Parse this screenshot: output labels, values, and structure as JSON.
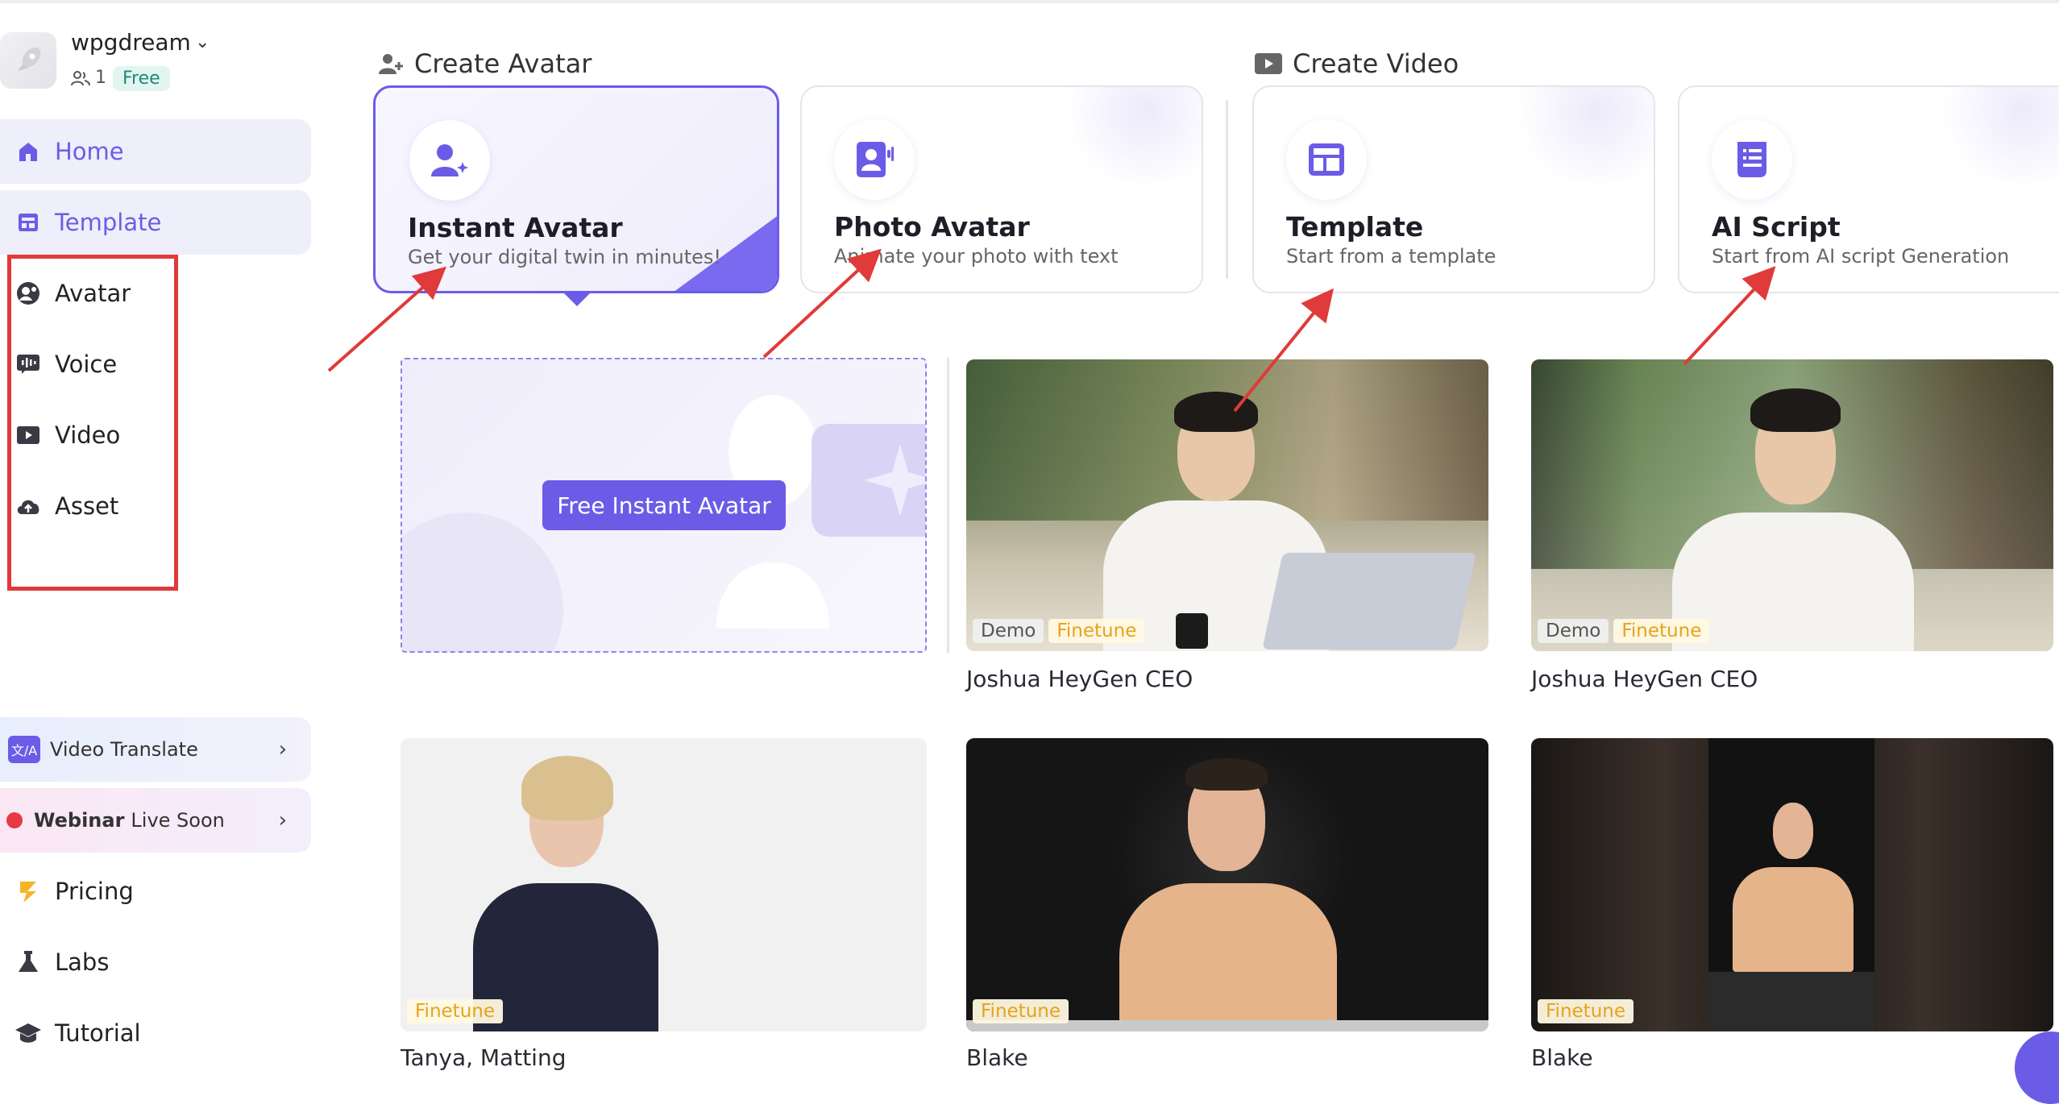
{
  "workspace": {
    "name": "wpgdream",
    "members": "1",
    "plan": "Free"
  },
  "sidebar": {
    "items": [
      {
        "label": "Home",
        "icon": "home-icon"
      },
      {
        "label": "Template",
        "icon": "template-icon"
      },
      {
        "label": "Avatar",
        "icon": "avatar-icon"
      },
      {
        "label": "Voice",
        "icon": "voice-icon"
      },
      {
        "label": "Video",
        "icon": "video-icon"
      },
      {
        "label": "Asset",
        "icon": "cloud-upload-icon"
      }
    ],
    "promos": {
      "translate": {
        "label": "Video Translate",
        "icon_text": "文/A"
      },
      "webinar": {
        "bold": "Webinar",
        "label": "Live Soon"
      }
    },
    "bottom_items": [
      {
        "label": "Pricing",
        "icon": "pricing-icon"
      },
      {
        "label": "Labs",
        "icon": "flask-icon"
      },
      {
        "label": "Tutorial",
        "icon": "graduation-cap-icon"
      }
    ]
  },
  "sections": {
    "create_avatar": "Create Avatar",
    "create_video": "Create Video"
  },
  "cards": [
    {
      "title": "Instant Avatar",
      "subtitle": "Get your digital twin in minutes!"
    },
    {
      "title": "Photo Avatar",
      "subtitle": "Animate your photo with text"
    },
    {
      "title": "Template",
      "subtitle": "Start from a template"
    },
    {
      "title": "AI Script",
      "subtitle": "Start from AI script Generation"
    }
  ],
  "create_tile": {
    "button": "Free Instant Avatar"
  },
  "avatars": [
    {
      "name": "Joshua HeyGen CEO",
      "badges": [
        "Demo",
        "Finetune"
      ]
    },
    {
      "name": "Joshua HeyGen CEO",
      "badges": [
        "Demo",
        "Finetune"
      ]
    },
    {
      "name": "Tanya, Matting",
      "badges": [
        "Finetune"
      ]
    },
    {
      "name": "Blake",
      "badges": [
        "Finetune"
      ]
    },
    {
      "name": "Blake",
      "badges": [
        "Finetune"
      ]
    }
  ],
  "colors": {
    "accent": "#6b5ce7",
    "annotation_red": "#e03a3a",
    "finetune": "#e7a31a"
  }
}
